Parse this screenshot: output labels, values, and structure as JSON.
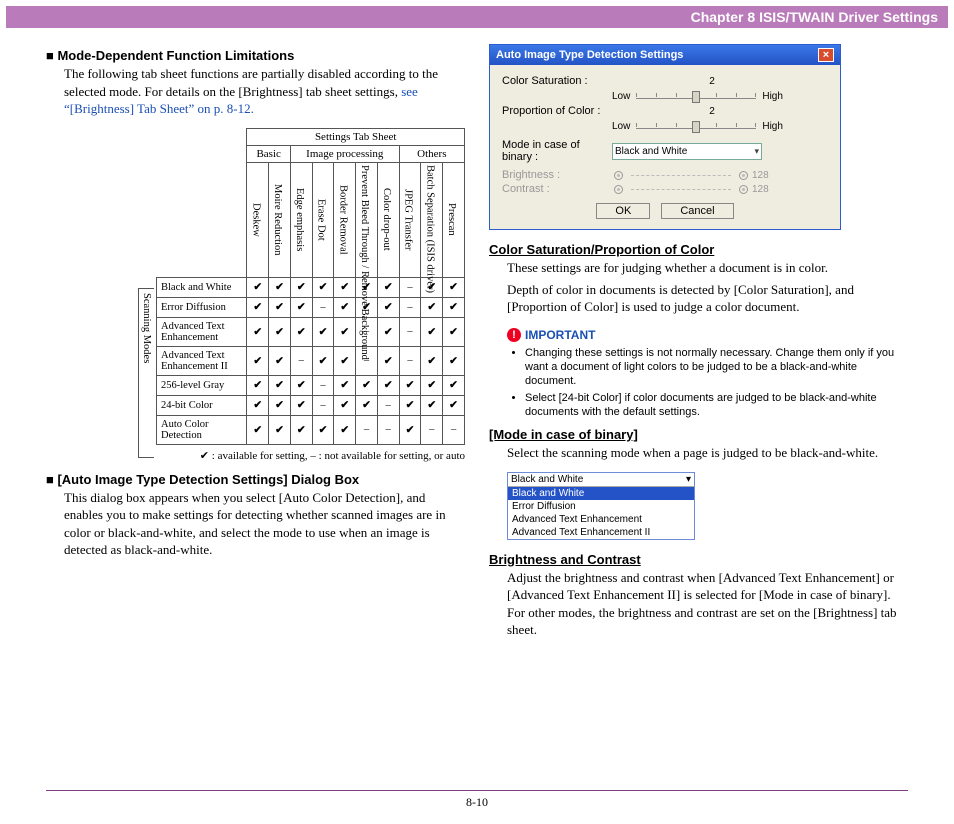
{
  "header": {
    "chapter": "Chapter 8   ISIS/TWAIN Driver Settings"
  },
  "left": {
    "h1": "Mode-Dependent Function Limitations",
    "intro_a": "The following tab sheet functions are partially disabled according to the selected mode. For details on the [Brightness] tab sheet settings, ",
    "intro_link": "see “[Brightness] Tab Sheet” on p. 8-12.",
    "table": {
      "caption": "Settings Tab Sheet",
      "groups": [
        "Basic",
        "Image processing",
        "Others"
      ],
      "cols": [
        "Deskew",
        "Moire Reduction",
        "Edge emphasis",
        "Erase Dot",
        "Border Removal",
        "Prevent Bleed Through / Remove Background",
        "Color drop-out",
        "JPEG Transfer",
        "Batch Separation (ISIS driver)",
        "Prescan"
      ],
      "side": "Scanning Modes",
      "rows": [
        {
          "label": "Black and White",
          "cells": [
            "✔",
            "✔",
            "✔",
            "✔",
            "✔",
            "✔",
            "✔",
            "–",
            "✔",
            "✔"
          ]
        },
        {
          "label": "Error Diffusion",
          "cells": [
            "✔",
            "✔",
            "✔",
            "–",
            "✔",
            "✔",
            "✔",
            "–",
            "✔",
            "✔"
          ]
        },
        {
          "label": "Advanced Text Enhancement",
          "cells": [
            "✔",
            "✔",
            "✔",
            "✔",
            "✔",
            "–",
            "✔",
            "–",
            "✔",
            "✔"
          ]
        },
        {
          "label": "Advanced Text Enhancement II",
          "cells": [
            "✔",
            "✔",
            "–",
            "✔",
            "✔",
            "–",
            "✔",
            "–",
            "✔",
            "✔"
          ]
        },
        {
          "label": "256-level Gray",
          "cells": [
            "✔",
            "✔",
            "✔",
            "–",
            "✔",
            "✔",
            "✔",
            "✔",
            "✔",
            "✔"
          ]
        },
        {
          "label": "24-bit Color",
          "cells": [
            "✔",
            "✔",
            "✔",
            "–",
            "✔",
            "✔",
            "–",
            "✔",
            "✔",
            "✔"
          ]
        },
        {
          "label": "Auto Color Detection",
          "cells": [
            "✔",
            "✔",
            "✔",
            "✔",
            "✔",
            "–",
            "–",
            "✔",
            "–",
            "–"
          ]
        }
      ]
    },
    "legend": "✔ : available for setting, – : not available for setting, or auto",
    "h2": "[Auto Image Type Detection Settings] Dialog Box",
    "p2": "This dialog box appears when you select [Auto Color Detection], and enables you to make settings for detecting whether scanned images are in color or black-and-white, and select the mode to use when an image is detected as black-and-white."
  },
  "dialog": {
    "title": "Auto Image Type Detection Settings",
    "color_sat_label": "Color Saturation :",
    "proportion_label": "Proportion of Color :",
    "value": "2",
    "low": "Low",
    "high": "High",
    "mode_label": "Mode in case of binary :",
    "mode_value": "Black and White",
    "brightness_label": "Brightness :",
    "contrast_label": "Contrast :",
    "num": "128",
    "ok": "OK",
    "cancel": "Cancel"
  },
  "right": {
    "h1": "Color Saturation/Proportion of Color",
    "p1a": "These settings are for judging whether a document is in color.",
    "p1b": "Depth of color in documents is detected by [Color Saturation], and [Proportion of Color] is used to judge a color document.",
    "important": "IMPORTANT",
    "bul1": "Changing these settings is not normally necessary. Change them only if you want a document of light colors to be judged to be a black-and-white document.",
    "bul2": "Select [24-bit Color] if color documents are judged to be black-and-white documents with the default settings.",
    "h2": "[Mode in case of binary]",
    "p2": "Select the scanning mode when a page is judged to be black-and-white.",
    "list": [
      "Black and White",
      "Error Diffusion",
      "Advanced Text Enhancement",
      "Advanced Text Enhancement II"
    ],
    "list_sel": "Black and White",
    "h3": "Brightness and Contrast",
    "p3": "Adjust the brightness and contrast when [Advanced Text Enhancement] or [Advanced Text Enhancement II] is selected for [Mode in case of binary]. For other modes, the brightness and contrast are set on the [Brightness] tab sheet."
  },
  "footer": {
    "page_no": "8-10"
  }
}
